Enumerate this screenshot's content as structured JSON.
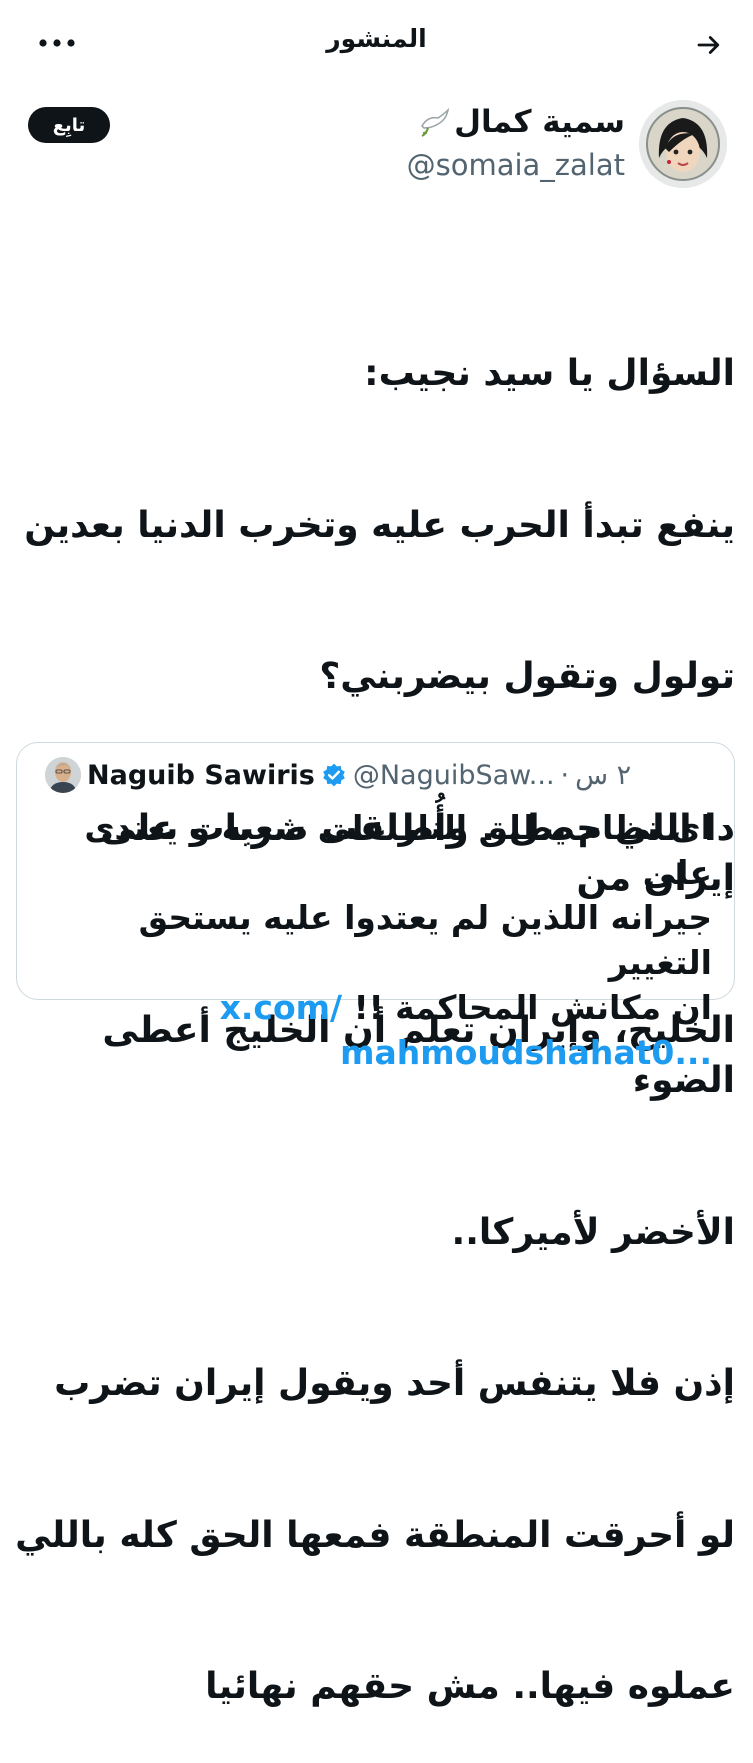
{
  "header": {
    "title": "المنشور",
    "back_icon": "arrow-right-icon",
    "more_icon": "more-horizontal-icon"
  },
  "author": {
    "display_name": "سمية كمال",
    "name_emoji": "🕊️",
    "handle": "@somaia_zalat",
    "follow_label": "تابِع"
  },
  "tweet": {
    "lines": [
      "السؤال يا سيد نجيب:",
      "ينفع تبدأ الحرب عليه وتخرب الدنيا بعدين",
      "تولول وتقول بيضربني؟",
      "دا اللي حصل.. وأُطلقت ضربات على إيران من",
      "الخليج، وإيران تعلم أن الخليج أعطى الضوء",
      "الأخضر لأميركا..",
      "إذن فلا يتنفس أحد ويقول إيران تضرب",
      "لو أحرقت المنطقة فمعها الحق كله باللي",
      "عملوه فيها.. مش حقهم نهائيا"
    ]
  },
  "quote": {
    "name": "Naguib Sawiris",
    "handle": "@NaguibSaw...",
    "separator": "·",
    "time": "٢ س",
    "line1": "اى نظام يطلق النار على شعبه و يعتدى على",
    "line2": "جيرانه اللذين لم يعتدوا عليه يستحق التغيير",
    "line3_text": "ان مكانش المحاكمة !!",
    "line3_link": "x.com/",
    "line4_link": "mahmoudshahat0...",
    "verified_color": "#1d9bf0"
  },
  "colors": {
    "text": "#0f1419",
    "secondary": "#536471",
    "link": "#1d9bf0",
    "border": "#cfd9de"
  }
}
